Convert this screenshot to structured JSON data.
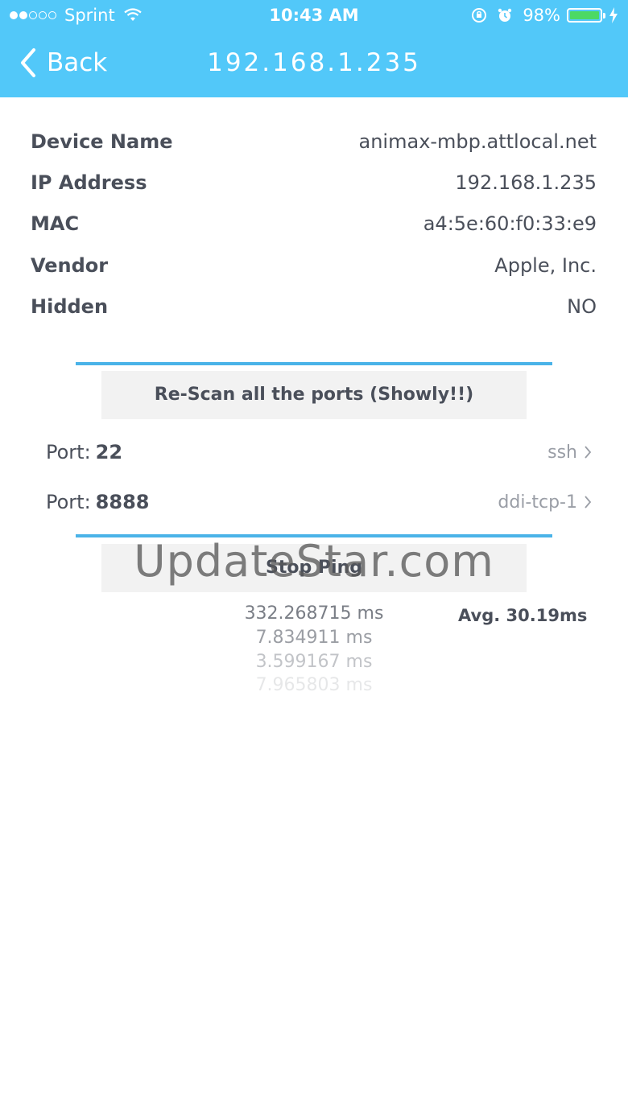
{
  "status_bar": {
    "carrier": "Sprint",
    "time": "10:43 AM",
    "battery": "98%"
  },
  "nav": {
    "back_label": "Back",
    "title": "192.168.1.235"
  },
  "device_info": [
    {
      "label": "Device Name",
      "value": "animax-mbp.attlocal.net"
    },
    {
      "label": "IP Address",
      "value": "192.168.1.235"
    },
    {
      "label": "MAC",
      "value": "a4:5e:60:f0:33:e9"
    },
    {
      "label": "Vendor",
      "value": "Apple, Inc."
    },
    {
      "label": "Hidden",
      "value": "NO"
    }
  ],
  "rescan_button": "Re-Scan all the ports (Showly!!)",
  "ports": [
    {
      "label": "Port:",
      "number": "22",
      "service": "ssh"
    },
    {
      "label": "Port:",
      "number": "8888",
      "service": "ddi-tcp-1"
    }
  ],
  "stop_ping_button": "Stop Ping",
  "ping_results": [
    "332.268715 ms",
    "7.834911 ms",
    "3.599167 ms",
    "7.965803 ms"
  ],
  "ping_average": "Avg. 30.19ms",
  "watermark": "UpdateStar.com",
  "colors": {
    "nav_background": "#52c8f9",
    "separator": "#4ab3e8",
    "battery_fill": "#4cd964",
    "button_background": "#f2f2f2"
  }
}
